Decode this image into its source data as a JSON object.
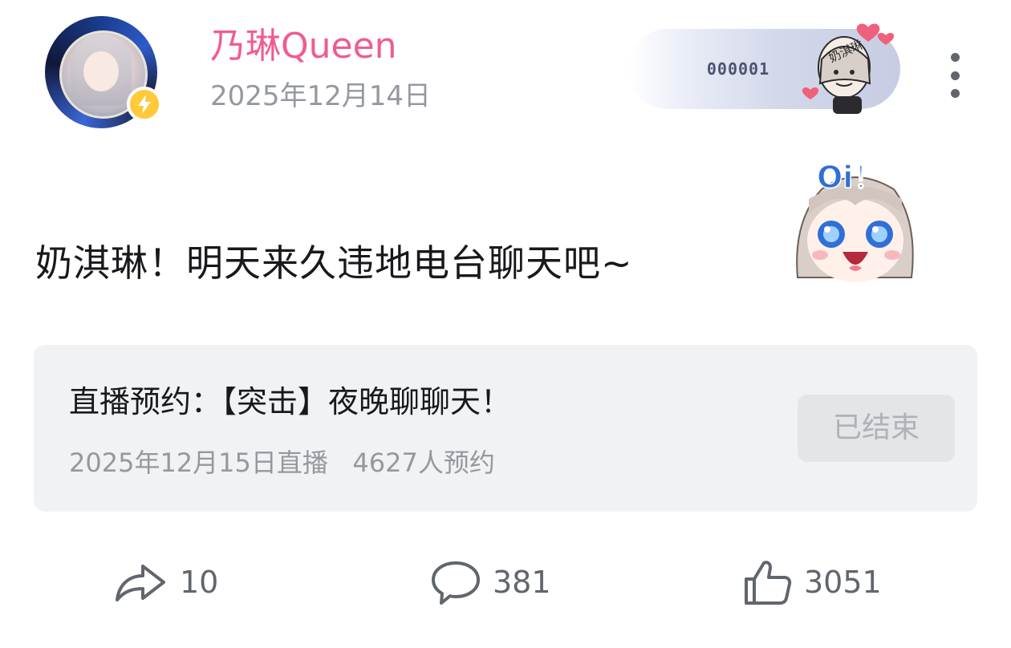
{
  "post": {
    "author": "乃琳Queen",
    "date": "2025年12月14日",
    "text": "奶淇琳！明天来久违地电台聊天吧~"
  },
  "fan_badge": {
    "number": "000001",
    "sticker_text": "奶淇琳"
  },
  "sticker": {
    "text": "Oi！"
  },
  "reservation": {
    "title": "直播预约：【突击】夜晚聊聊天！",
    "meta": "2025年12月15日直播   4627人预约",
    "button_label": "已结束"
  },
  "actions": {
    "forward_count": "10",
    "comment_count": "381",
    "like_count": "3051"
  },
  "colors": {
    "username": "#f15b92",
    "secondary_text": "#9499a0",
    "card_bg": "#f1f2f3",
    "badge_yellow": "#ffc93a"
  },
  "icons": [
    "lightning-icon",
    "more-icon",
    "forward-icon",
    "comment-icon",
    "like-icon"
  ]
}
